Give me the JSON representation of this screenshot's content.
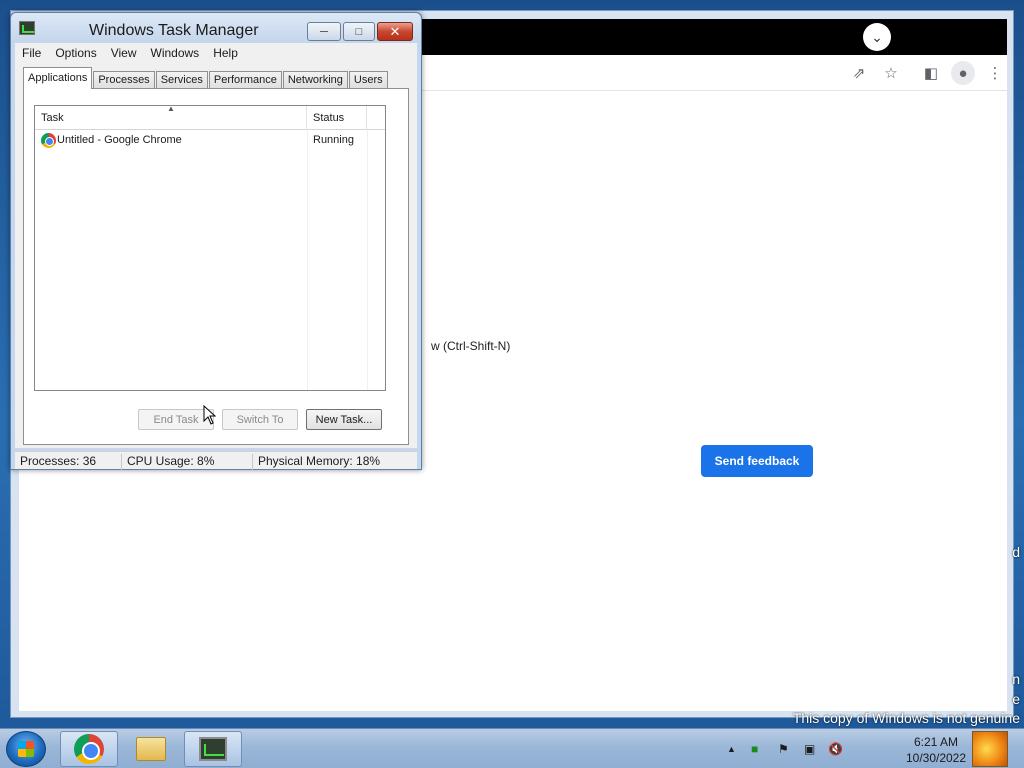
{
  "desktop": {
    "watermark_text": "This copy of Windows is not genuine",
    "watermark_fragment_d": "d",
    "watermark_fragment_n": "n",
    "watermark_fragment_e": "e"
  },
  "chrome": {
    "page_hint_fragment": "w (Ctrl-Shift-N)",
    "send_feedback_label": "Send feedback",
    "icons": {
      "tab_search": "chevron-down-icon",
      "share": "share-icon",
      "bookmark": "star-icon",
      "side_panel": "side-panel-icon",
      "profile": "profile-icon",
      "menu": "more-vert-icon"
    }
  },
  "taskmgr": {
    "title": "Windows Task Manager",
    "menu": [
      "File",
      "Options",
      "View",
      "Windows",
      "Help"
    ],
    "tabs": [
      "Applications",
      "Processes",
      "Services",
      "Performance",
      "Networking",
      "Users"
    ],
    "active_tab": "Applications",
    "columns": {
      "task": "Task",
      "status": "Status"
    },
    "rows": [
      {
        "name": "Untitled - Google Chrome",
        "status": "Running"
      }
    ],
    "buttons": {
      "end_task": "End Task",
      "switch_to": "Switch To",
      "new_task": "New Task..."
    },
    "status": {
      "processes": "Processes: 36",
      "cpu": "CPU Usage: 8%",
      "memory": "Physical Memory: 18%"
    }
  },
  "taskbar": {
    "items": [
      "chrome-icon",
      "windows-explorer-icon",
      "task-manager-icon"
    ],
    "clock_time": "6:21 AM",
    "clock_date": "10/30/2022",
    "tray": [
      "show-hidden-icons",
      "network-status-icon",
      "action-center-flag-icon",
      "network-icon",
      "volume-muted-icon"
    ]
  },
  "colors": {
    "send_feedback_blue": "#1a73e8",
    "close_button_red": "#c9472e",
    "taskbar_blue": "#9bb7d8"
  }
}
